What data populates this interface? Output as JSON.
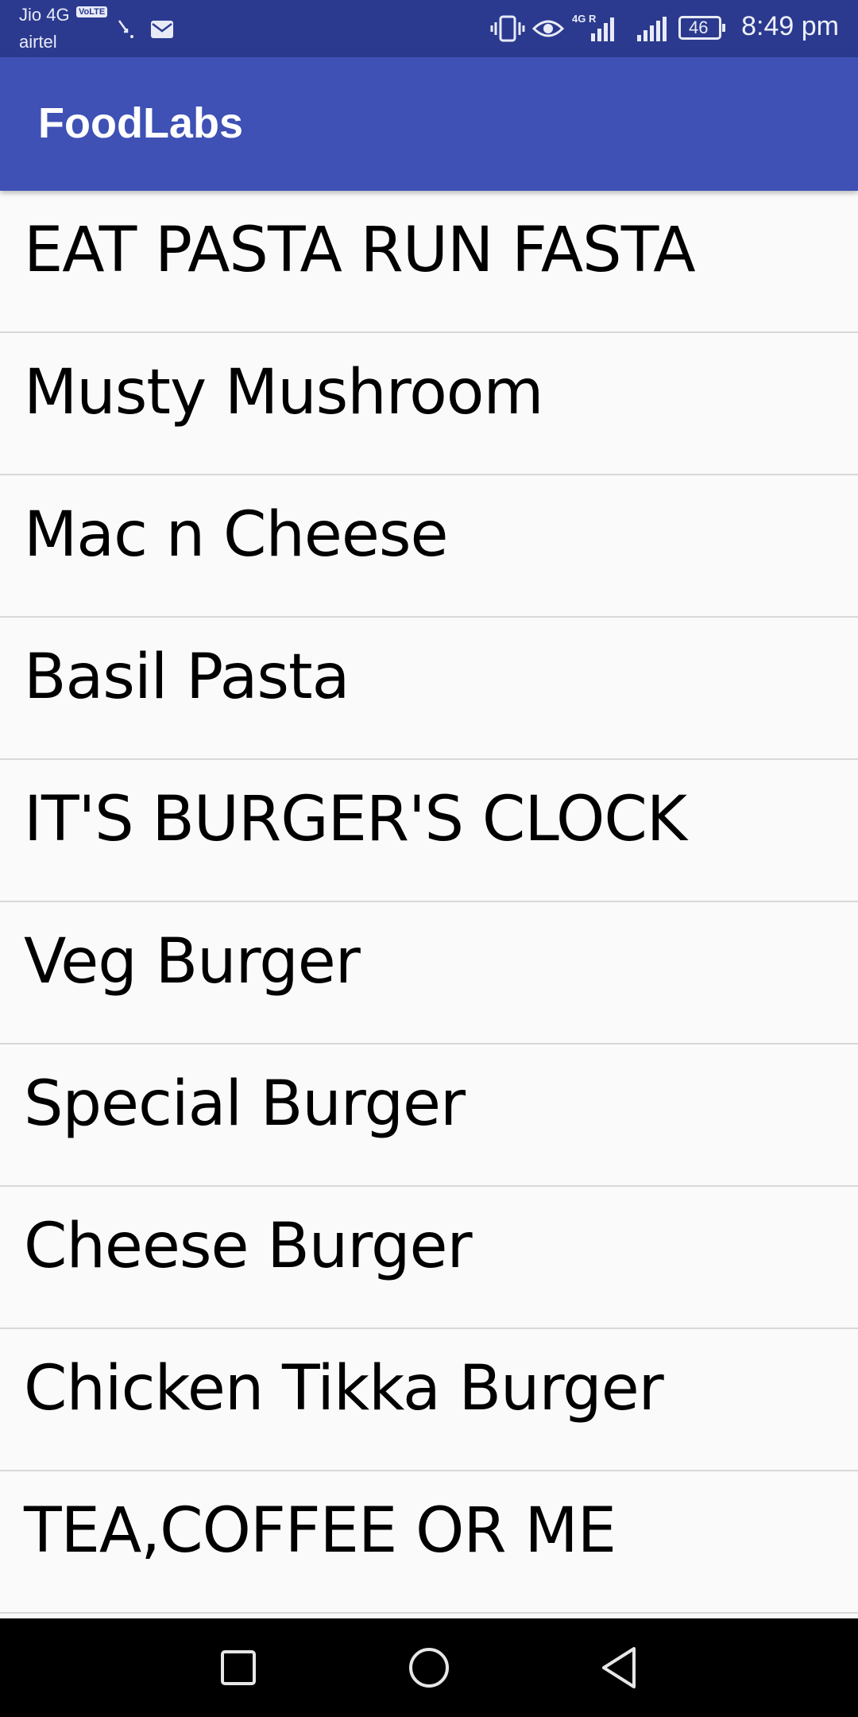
{
  "status_bar": {
    "carrier_primary": "Jio 4G",
    "volte_badge": "VoLTE",
    "carrier_secondary": "airtel",
    "network_type": "4G R",
    "battery_level": "46",
    "time": "8:49 pm"
  },
  "app_bar": {
    "title": "FoodLabs"
  },
  "menu": {
    "items": [
      {
        "label": "EAT PASTA RUN FASTA"
      },
      {
        "label": "Musty Mushroom"
      },
      {
        "label": "Mac n Cheese"
      },
      {
        "label": "Basil Pasta"
      },
      {
        "label": "IT'S BURGER'S CLOCK"
      },
      {
        "label": "Veg Burger"
      },
      {
        "label": "Special Burger"
      },
      {
        "label": "Cheese Burger"
      },
      {
        "label": "Chicken Tikka Burger"
      },
      {
        "label": "TEA,COFFEE OR ME"
      }
    ]
  },
  "nav_bar": {
    "buttons": [
      "recents-button",
      "home-button",
      "back-button"
    ]
  }
}
